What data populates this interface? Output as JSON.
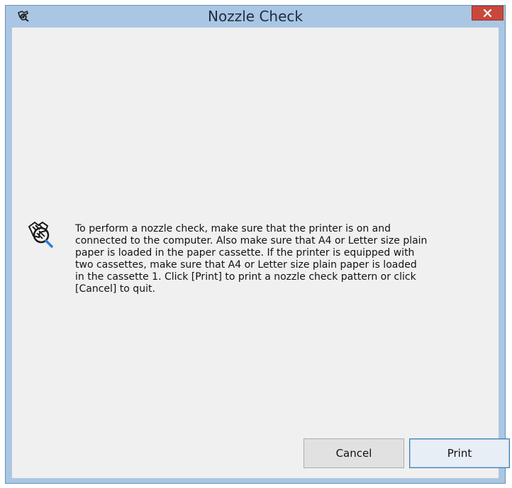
{
  "window": {
    "title": "Nozzle Check",
    "icon": "printer-nozzle-icon",
    "close_icon": "close-icon",
    "accent_color": "#a9c6e4",
    "close_color": "#c9483c"
  },
  "message": {
    "icon": "nozzle-check-icon",
    "text": "To perform a nozzle check, make sure that the printer is on and\nconnected to the computer. Also make sure that A4 or Letter size plain\npaper is loaded in the paper cassette. If the printer is equipped with\ntwo cassettes, make sure that A4 or Letter size plain paper is loaded\nin the cassette 1. Click [Print] to print a nozzle check pattern or click\n[Cancel] to quit."
  },
  "buttons": {
    "cancel_label": "Cancel",
    "print_label": "Print"
  }
}
